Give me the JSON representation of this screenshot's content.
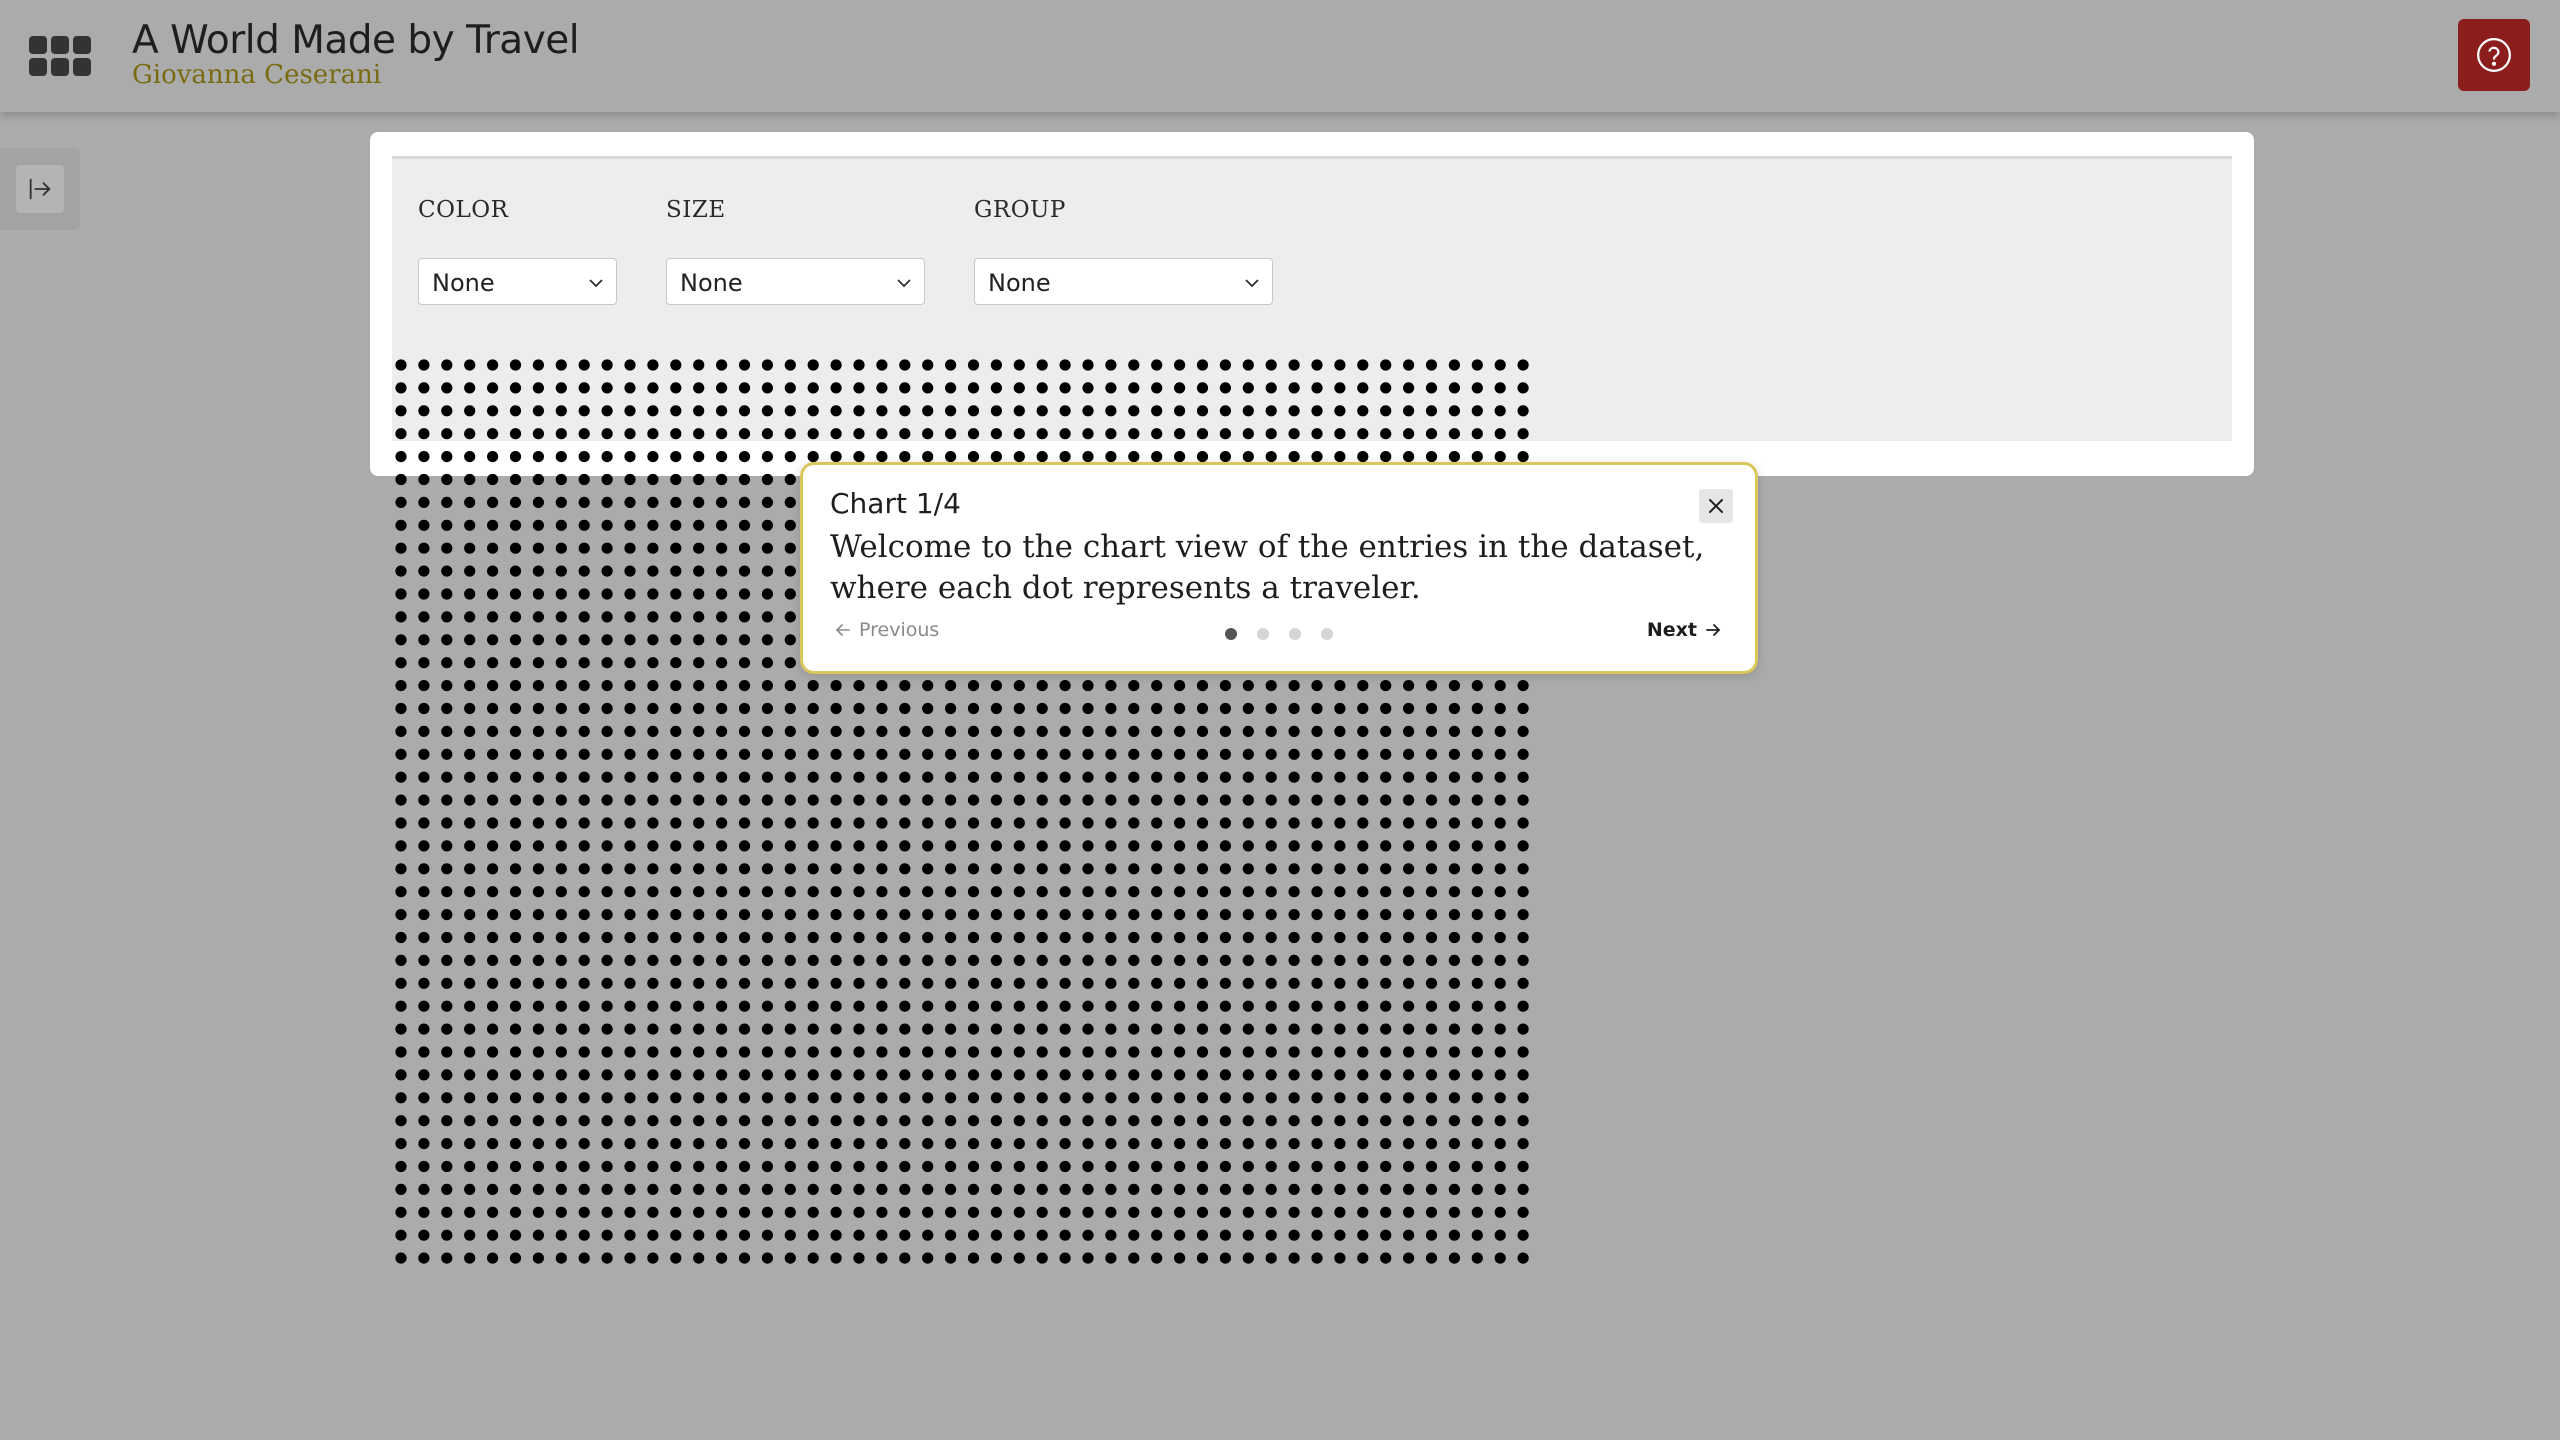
{
  "header": {
    "apps_icon": "grid-icon",
    "title": "A World Made by Travel",
    "author": "Giovanna Ceserani",
    "help_icon": "question-circle-icon",
    "help_color": "#8c1d1d",
    "author_color": "#7a6a12"
  },
  "sidebar_toggle": {
    "icon": "expand-sidebar-icon"
  },
  "controls": {
    "color": {
      "label": "COLOR",
      "value": "None"
    },
    "size": {
      "label": "SIZE",
      "value": "None"
    },
    "group": {
      "label": "GROUP",
      "value": "None"
    }
  },
  "tour": {
    "title": "Chart 1/4",
    "body": "Welcome to the chart view of the entries in the dataset, where each dot represents a traveler.",
    "previous_label": "Previous",
    "next_label": "Next",
    "step_count": 4,
    "current_step": 1,
    "border_color": "#d9c75c"
  },
  "chart_data": {
    "type": "scatter",
    "description_source": "tour",
    "dot_color": "#000000",
    "encoding": {
      "color": "None",
      "size": "None",
      "group": "None"
    }
  }
}
